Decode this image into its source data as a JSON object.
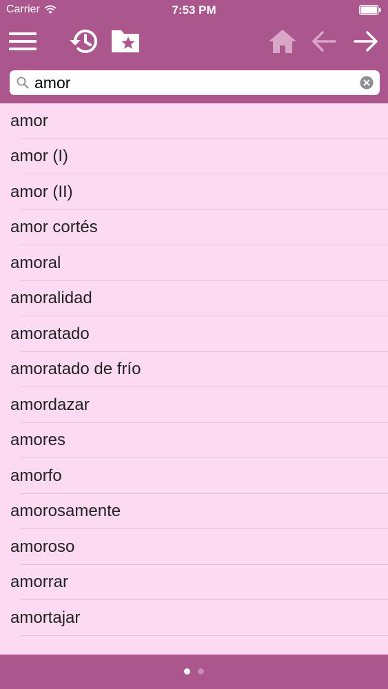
{
  "status_bar": {
    "carrier": "Carrier",
    "time": "7:53 PM",
    "wifi_icon": "wifi-icon",
    "battery_icon": "battery-icon"
  },
  "toolbar": {
    "menu_icon": "hamburger-menu-icon",
    "history_icon": "history-clock-icon",
    "favorites_icon": "folder-star-icon",
    "home_icon": "home-icon",
    "back_icon": "arrow-left-icon",
    "forward_icon": "arrow-right-icon"
  },
  "search": {
    "value": "amor",
    "placeholder": "",
    "search_icon": "magnifier-icon",
    "clear_icon": "clear-circle-icon"
  },
  "results": [
    "amor",
    "amor (I)",
    "amor (II)",
    "amor cortés",
    "amoral",
    "amoralidad",
    "amoratado",
    "amoratado de frío",
    "amordazar",
    "amores",
    "amorfo",
    "amorosamente",
    "amoroso",
    "amorrar",
    "amortajar"
  ],
  "pager": {
    "pages": 2,
    "current": 1
  },
  "colors": {
    "header": "#ab578d",
    "list_background": "#fcdaf2",
    "separator": "#e9bcd7",
    "icon_active": "#ffffff",
    "icon_disabled": "#d9a6c8"
  }
}
